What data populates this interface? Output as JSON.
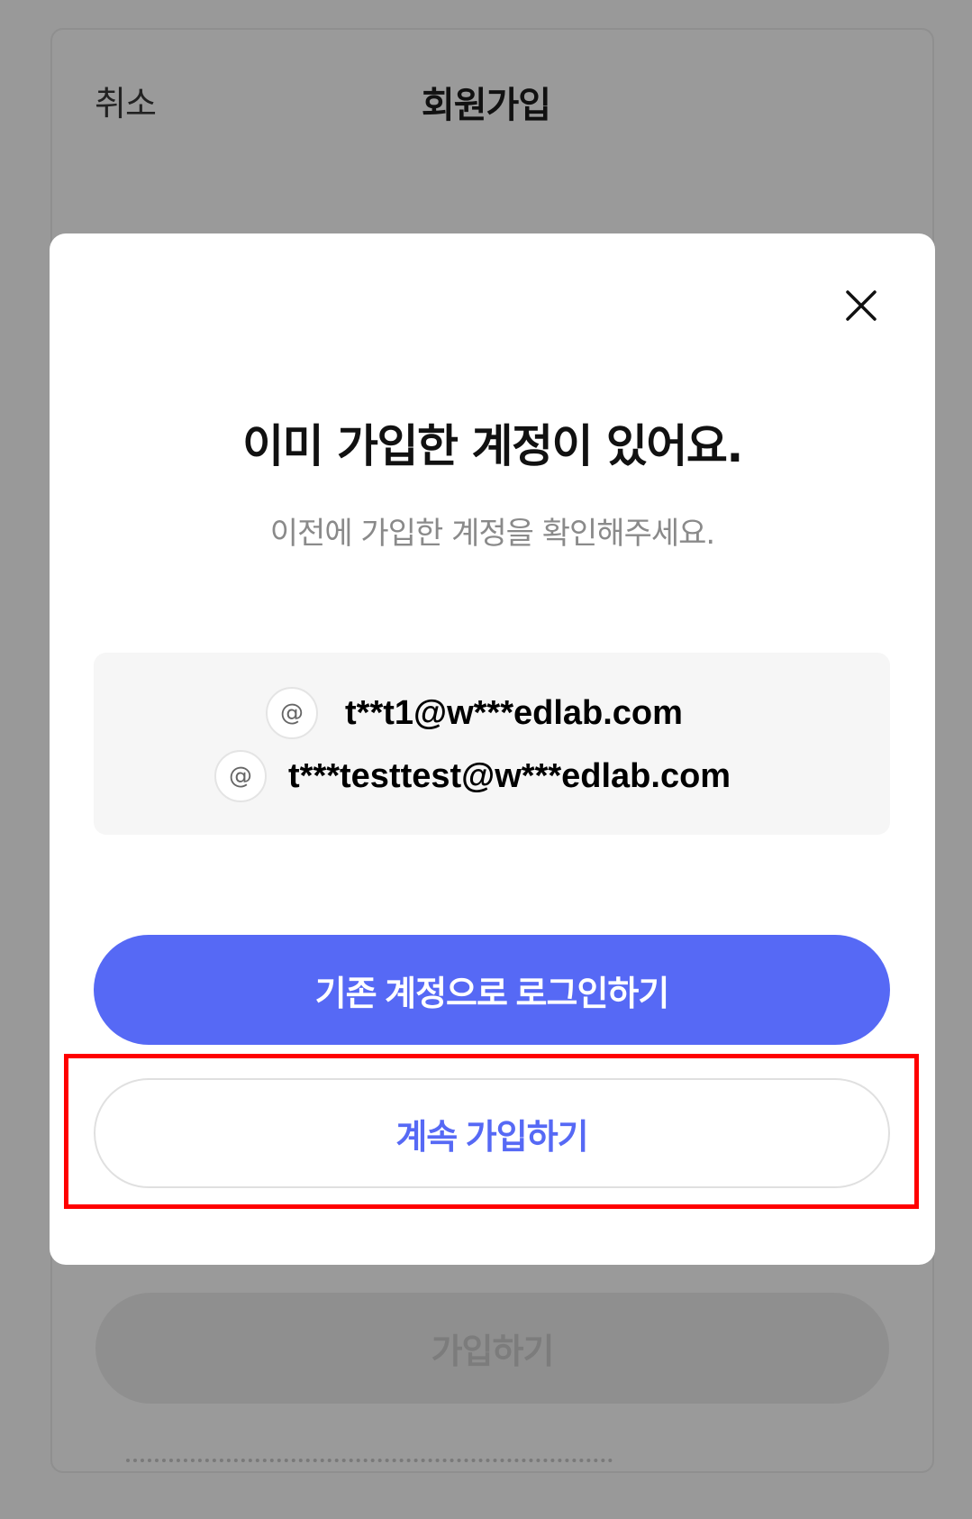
{
  "background_page": {
    "cancel_label": "취소",
    "title": "회원가입",
    "submit_label": "가입하기"
  },
  "modal": {
    "close_icon": "close-icon",
    "title": "이미 가입한 계정이 있어요.",
    "subtitle": "이전에 가입한 계정을 확인해주세요.",
    "accounts": [
      {
        "icon": "@",
        "email": "t**t1@w***edlab.com"
      },
      {
        "icon": "@",
        "email": "t***testtest@w***edlab.com"
      }
    ],
    "login_button_label": "기존 계정으로 로그인하기",
    "continue_button_label": "계속 가입하기"
  },
  "colors": {
    "accent": "#5669f5",
    "highlight": "#ff0000",
    "overlay": "#999999"
  }
}
